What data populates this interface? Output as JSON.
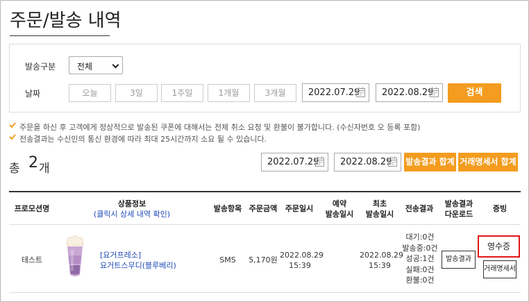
{
  "page": {
    "title": "주문/발송 내역"
  },
  "filter": {
    "type_label": "발송구분",
    "type_value": "전체",
    "date_label": "날짜",
    "periods": [
      "오늘",
      "3일",
      "1주일",
      "1개월",
      "3개월"
    ],
    "start_date": "2022.07.29",
    "end_date": "2022.08.29",
    "search_label": "검색"
  },
  "notices": [
    "주문을 하신 후 고객에게 정상적으로 발송된 쿠폰에 대해서는 전체 취소 요청 및 환불이 불가합니다. (수신자번호 오 등록 포함)",
    "전송결과는 수신인의 통신 환경에 따라 최대 25시간까지 소요 될 수 있습니다."
  ],
  "summary": {
    "total_label": "총",
    "total_count": "2",
    "total_unit": "개",
    "start_date": "2022.07.29",
    "end_date": "2022.08.29",
    "result_sum_label": "발송결과 합계",
    "invoice_sum_label": "거래명세서 합계"
  },
  "table": {
    "headers": {
      "promotion": "프로모션명",
      "product": "상품정보",
      "product_sub": "(클릭시 상세 내역 확인)",
      "send_item": "발송항목",
      "amount": "주문금액",
      "order_date": "주문일시",
      "reserve_1": "예약",
      "reserve_2": "발송일시",
      "first_1": "최초",
      "first_2": "발송일시",
      "result": "전송결과",
      "download_1": "발송결과",
      "download_2": "다운로드",
      "proof": "증빙"
    },
    "rows": [
      {
        "promotion": "테스트",
        "brand": "[요거프레소]",
        "product_name": "요거트스무디(블루베리)",
        "send_item": "SMS",
        "amount": "5,170원",
        "order_date": "2022.08.29",
        "order_time": "15:39",
        "first_date": "2022.08.29",
        "first_time": "15:39",
        "result_lines": [
          "대기:0건",
          "발송중:0건",
          "성공:1건",
          "실패:0건",
          "환불:0건"
        ],
        "download_label": "발송결과",
        "receipt_label": "영수증",
        "invoice_label": "거래명세서"
      }
    ]
  },
  "colors": {
    "accent": "#f39c1f",
    "link": "#1d49b8",
    "highlight": "#e0161c"
  }
}
